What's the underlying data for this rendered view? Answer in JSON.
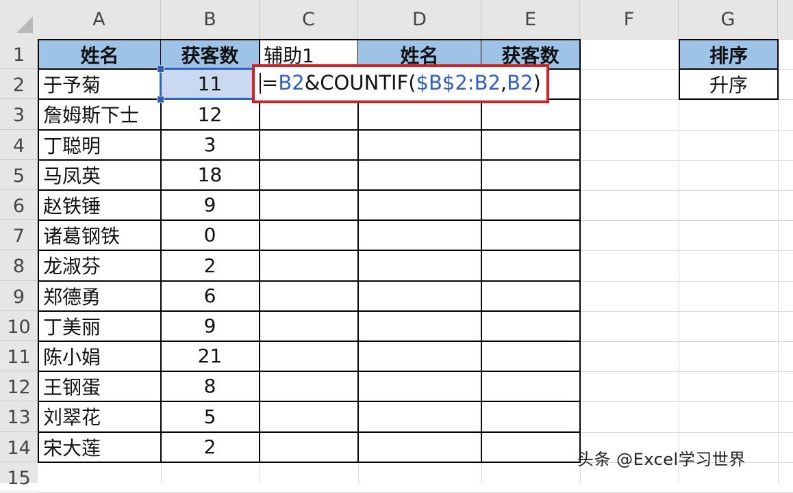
{
  "columns": [
    "A",
    "B",
    "C",
    "D",
    "E",
    "F",
    "G"
  ],
  "rows": [
    "1",
    "2",
    "3",
    "4",
    "5",
    "6",
    "7",
    "8",
    "9",
    "10",
    "11",
    "12",
    "13",
    "14",
    "15"
  ],
  "table": {
    "headers": [
      "姓名",
      "获客数"
    ],
    "records": [
      [
        "于予菊",
        "11"
      ],
      [
        "詹姆斯下士",
        "12"
      ],
      [
        "丁聪明",
        "3"
      ],
      [
        "马凤英",
        "18"
      ],
      [
        "赵铁锤",
        "9"
      ],
      [
        "诸葛钢铁",
        "0"
      ],
      [
        "龙淑芬",
        "2"
      ],
      [
        "郑德勇",
        "6"
      ],
      [
        "丁美丽",
        "9"
      ],
      [
        "陈小娟",
        "21"
      ],
      [
        "王钢蛋",
        "8"
      ],
      [
        "刘翠花",
        "5"
      ],
      [
        "宋大莲",
        "2"
      ]
    ]
  },
  "helper": {
    "header": "辅助1"
  },
  "result_table": {
    "headers": [
      "姓名",
      "获客数"
    ]
  },
  "sort": {
    "header": "排序",
    "value": "升序"
  },
  "formula": {
    "tokens": [
      {
        "text": "=",
        "kind": "plain"
      },
      {
        "text": "B2",
        "kind": "ref"
      },
      {
        "text": "&COUNTIF(",
        "kind": "plain"
      },
      {
        "text": "$B$2:B2",
        "kind": "ref"
      },
      {
        "text": ",",
        "kind": "plain"
      },
      {
        "text": "B2",
        "kind": "ref"
      },
      {
        "text": ")",
        "kind": "plain"
      }
    ]
  },
  "watermark": "头条 @Excel学习世界",
  "colors": {
    "header_fill": "#9dc3e6",
    "selection": "#2b5fc6",
    "highlight_box": "#d32020",
    "reference_text": "#2e5fcf"
  }
}
